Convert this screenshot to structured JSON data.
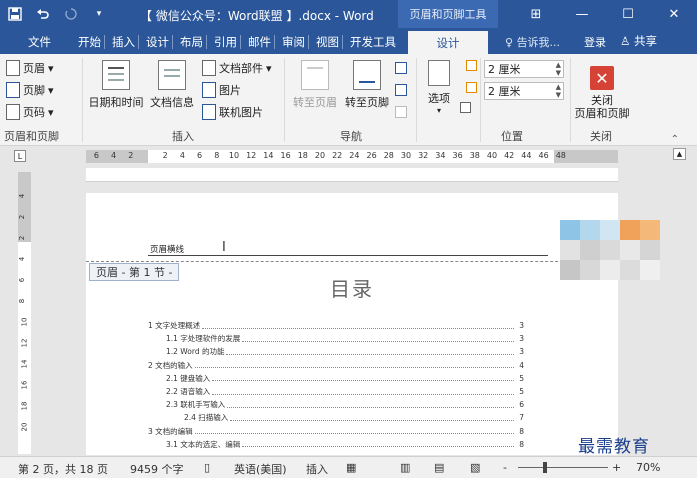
{
  "titlebar": {
    "title": "【 微信公众号：Word联盟 】.docx - Word",
    "context_tab": "页眉和页脚工具",
    "qat": {
      "save_icon": "save-icon",
      "undo_icon": "undo-icon",
      "redo_icon": "redo-icon",
      "customize_icon": "customize-qat-icon"
    },
    "window": {
      "ribbon_display": "⊞",
      "minimize": "—",
      "maximize": "☐",
      "close": "✕"
    }
  },
  "tabs": [
    {
      "label": "文件"
    },
    {
      "label": "开始"
    },
    {
      "label": "插入"
    },
    {
      "label": "设计"
    },
    {
      "label": "布局"
    },
    {
      "label": "引用"
    },
    {
      "label": "邮件"
    },
    {
      "label": "审阅"
    },
    {
      "label": "视图"
    },
    {
      "label": "开发工具"
    }
  ],
  "active_tab": "设计",
  "tell_me": "告诉我...",
  "login": "登录",
  "share": "共享",
  "ribbon": {
    "header_footer": {
      "header": "页眉",
      "footer": "页脚",
      "page_number": "页码",
      "label": "页眉和页脚"
    },
    "insert": {
      "date_time": "日期和时间",
      "doc_info": "文档信息",
      "quick_parts": "文档部件",
      "pictures": "图片",
      "online_pictures": "联机图片",
      "label": "插入"
    },
    "navigation": {
      "goto_header": "转至页眉",
      "goto_footer": "转至页脚",
      "label": "导航"
    },
    "options": {
      "label": "选项"
    },
    "position": {
      "header_dist": "2 厘米",
      "footer_dist": "2 厘米",
      "label": "位置"
    },
    "close": {
      "button": "关闭\n页眉和页脚",
      "line1": "关闭",
      "line2": "页眉和页脚",
      "label": "关闭"
    }
  },
  "ruler": {
    "ticks_left": [
      "6",
      "4",
      "2"
    ],
    "ticks_right": [
      "2",
      "4",
      "6",
      "8",
      "10",
      "12",
      "14",
      "16",
      "18",
      "20",
      "22",
      "24",
      "26",
      "28",
      "30",
      "32",
      "34",
      "36",
      "38",
      "40",
      "42",
      "44",
      "46",
      "48"
    ],
    "vticks": [
      "4",
      "2",
      "2",
      "4",
      "6",
      "8",
      "10",
      "12",
      "14",
      "16",
      "18",
      "20"
    ]
  },
  "document": {
    "header_text": "页眉横线",
    "header_tag": "页眉 - 第 1 节 -",
    "toc_title": "目录",
    "toc": [
      {
        "text": "1 文字处理概述",
        "page": "3",
        "level": 1
      },
      {
        "text": "1.1 字处理软件的发展",
        "page": "3",
        "level": 2
      },
      {
        "text": "1.2 Word 的功能",
        "page": "3",
        "level": 2
      },
      {
        "text": "2 文档的输入",
        "page": "4",
        "level": 1
      },
      {
        "text": "2.1 键盘输入",
        "page": "5",
        "level": 2
      },
      {
        "text": "2.2 语音输入",
        "page": "5",
        "level": 2
      },
      {
        "text": "2.3 联机手写输入",
        "page": "6",
        "level": 2
      },
      {
        "text": "2.4 扫描输入",
        "page": "7",
        "level": 3
      },
      {
        "text": "3 文档的编辑",
        "page": "8",
        "level": 1
      },
      {
        "text": "3.1 文本的选定、编辑",
        "page": "8",
        "level": 2
      }
    ]
  },
  "watermark": "最需教育",
  "statusbar": {
    "page": "第 2 页，共 18 页",
    "words": "9459 个字",
    "language": "英语(美国)",
    "insert_mode": "插入",
    "zoom": "70%",
    "zoom_minus": "-",
    "zoom_plus": "+"
  },
  "colors": {
    "brand": "#2b579a",
    "close_red": "#d64236",
    "watermark": "#1b3f8b"
  }
}
